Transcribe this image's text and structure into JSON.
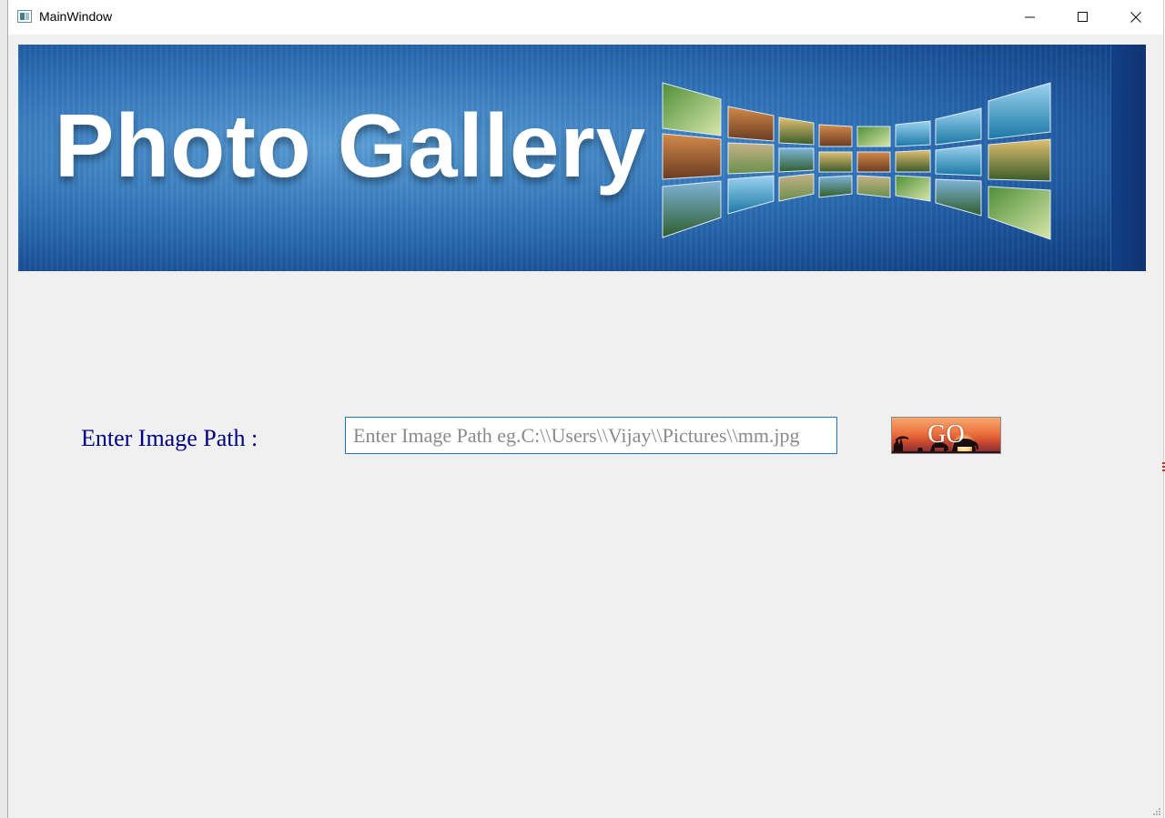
{
  "window": {
    "title": "MainWindow"
  },
  "banner": {
    "title": "Photo Gallery"
  },
  "form": {
    "path_label": "Enter Image Path :",
    "path_value": "",
    "path_placeholder": "Enter Image Path eg.C:\\\\Users\\\\Vijay\\\\Pictures\\\\mm.jpg",
    "go_label": "GO"
  },
  "icons": {
    "app": "window-app-icon",
    "minimize": "minimize-icon",
    "maximize": "maximize-icon",
    "close": "close-icon",
    "resize": "resize-grip-icon"
  },
  "colors": {
    "label": "#000080",
    "input_border": "#1e73be",
    "banner_blue": "#1f5fa8",
    "window_bg": "#f0f0f0"
  }
}
